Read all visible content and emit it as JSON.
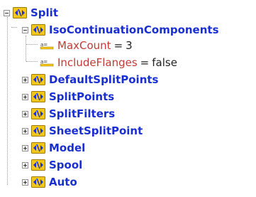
{
  "tree": {
    "root": {
      "label": "Split",
      "expanded": true,
      "icon": "xml-element-icon"
    },
    "child_expanded": {
      "label": "IsoContinuationComponents",
      "expanded": true,
      "attributes": [
        {
          "name": "MaxCount",
          "value": "3",
          "icon": "attribute-icon"
        },
        {
          "name": "IncludeFlanges",
          "value": "false",
          "icon": "attribute-icon"
        }
      ]
    },
    "children": [
      "DefaultSplitPoints",
      "SplitPoints",
      "SplitFilters",
      "SheetSplitPoint",
      "Model",
      "Spool",
      "Auto"
    ],
    "equals_sign": "=",
    "colors": {
      "element_label": "#1a2fd1",
      "attribute_label": "#c23a36",
      "icon_yellow": "#f4c617",
      "icon_blue": "#1f2fd0"
    }
  }
}
